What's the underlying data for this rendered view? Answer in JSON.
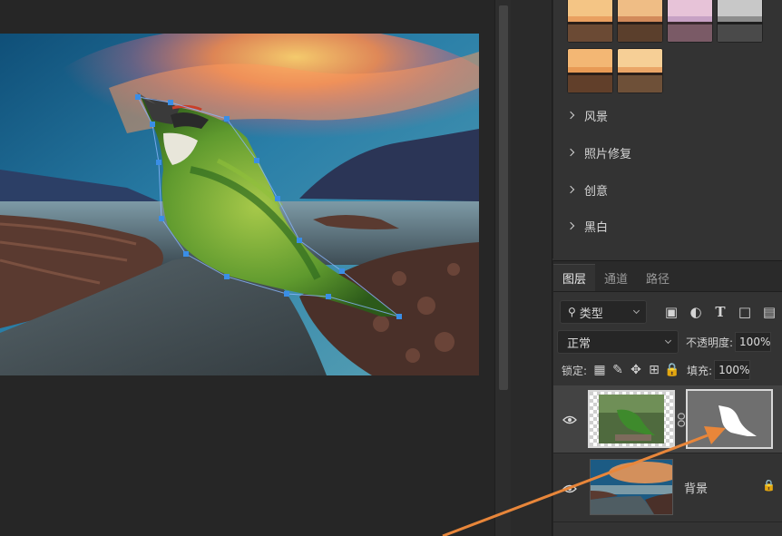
{
  "presets": {
    "categories": [
      {
        "label": "风景"
      },
      {
        "label": "照片修复"
      },
      {
        "label": "创意"
      },
      {
        "label": "黑白"
      }
    ]
  },
  "layers_panel": {
    "tabs": [
      {
        "label": "图层",
        "active": true
      },
      {
        "label": "通道",
        "active": false
      },
      {
        "label": "路径",
        "active": false
      }
    ],
    "filter": {
      "label": "类型"
    },
    "blend_mode": "正常",
    "opacity_label": "不透明度:",
    "opacity_value": "100%",
    "lock_label": "锁定:",
    "fill_label": "填充:",
    "fill_value": "100%",
    "layers": [
      {
        "name": "",
        "visible": true,
        "has_mask": true,
        "selected": true
      },
      {
        "name": "背景",
        "visible": true,
        "locked": true,
        "selected": false
      }
    ]
  },
  "annotation": {
    "arrow_color": "#e8863a"
  },
  "colors": {
    "accent_handle": "#3a8ee6",
    "panel_bg": "#333333"
  }
}
